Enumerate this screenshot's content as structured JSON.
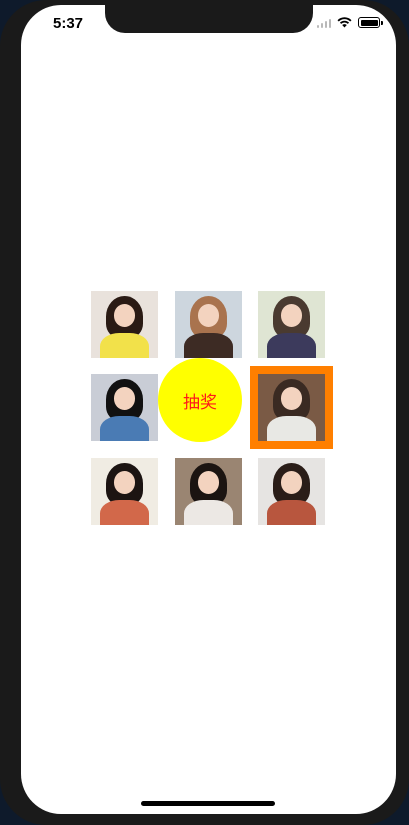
{
  "status_bar": {
    "time": "5:37",
    "icons": [
      "signal-icon",
      "wifi-icon",
      "battery-icon"
    ]
  },
  "lottery": {
    "draw_button_label": "抽奖",
    "colors": {
      "button_bg": "#ffff00",
      "button_text": "#ff1a1a",
      "highlight_border": "#ff7f00"
    },
    "selected_index": 5,
    "photos": [
      {
        "name": "photo-1",
        "bg": "#e9e2dc",
        "hair": "#2a1a14",
        "body": "#f2e14a"
      },
      {
        "name": "photo-2",
        "bg": "#cdd6de",
        "hair": "#a9734e",
        "body": "#3d2b24"
      },
      {
        "name": "photo-3",
        "bg": "#dfe5d3",
        "hair": "#4a3a30",
        "body": "#3c3a5c"
      },
      {
        "name": "photo-4",
        "bg": "#c9cdd6",
        "hair": "#111111",
        "body": "#4a7bb4"
      },
      {
        "name": "photo-6",
        "bg": "#7a5a45",
        "hair": "#3a2a22",
        "body": "#e8e8e4"
      },
      {
        "name": "photo-7",
        "bg": "#f0ece3",
        "hair": "#1c1412",
        "body": "#d2684a"
      },
      {
        "name": "photo-8",
        "bg": "#9a8572",
        "hair": "#1b1411",
        "body": "#ece8e4"
      },
      {
        "name": "photo-9",
        "bg": "#e6e4e2",
        "hair": "#2a1d18",
        "body": "#b8563e"
      }
    ]
  }
}
